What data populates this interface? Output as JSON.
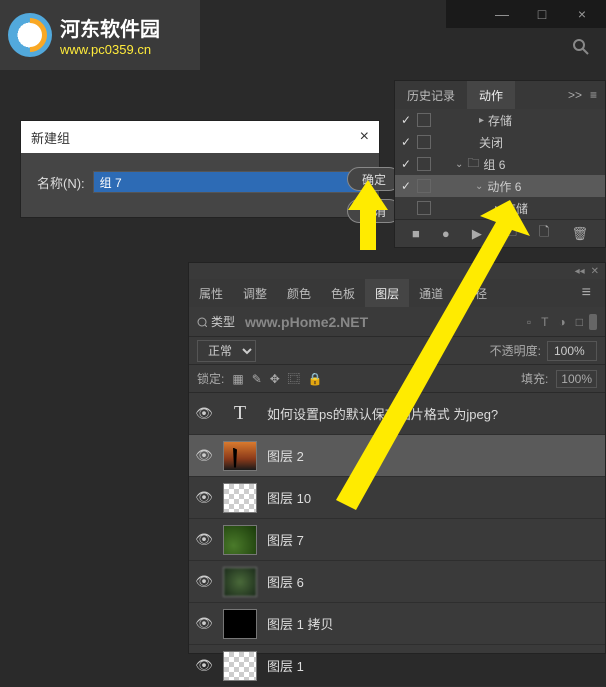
{
  "logo": {
    "title": "河东软件园",
    "subtitle": "www.pc0359.cn"
  },
  "titlebar": {
    "minimize": "—",
    "maximize": "□",
    "close": "×"
  },
  "dialog": {
    "title": "新建组",
    "close": "×",
    "name_label": "名称(N):",
    "name_value": "组 7",
    "ok": "确定",
    "cancel": "取消"
  },
  "actions_panel": {
    "tabs": {
      "history": "历史记录",
      "actions": "动作"
    },
    "menu": ">>",
    "burger": "≡",
    "items": [
      {
        "check": "✓",
        "arrow": "▸",
        "label": "存储",
        "indent": 40
      },
      {
        "check": "✓",
        "arrow": "",
        "label": "关闭",
        "indent": 40
      },
      {
        "check": "✓",
        "arrow": "⌄",
        "folder": "🗀",
        "label": "组 6",
        "indent": 16,
        "open": true
      },
      {
        "check": "✓",
        "arrow": "⌄",
        "label": "动作 6",
        "indent": 36,
        "selected": true
      },
      {
        "check": "",
        "arrow": "▸",
        "label": "存储",
        "indent": 56
      }
    ],
    "footer_icons": [
      "■",
      "●",
      "▶",
      "🗀",
      "🗋",
      "🗑"
    ]
  },
  "layers_panel": {
    "topbar": [
      "◂◂",
      "✕"
    ],
    "tabs": [
      "属性",
      "调整",
      "颜色",
      "色板",
      "图层",
      "通道",
      "路径"
    ],
    "active_tab": 4,
    "menu": "≡",
    "filter": {
      "kind_label": "类型",
      "watermark": "www.pHome2.NET",
      "icons": [
        "▫",
        "T",
        "◑",
        "□"
      ]
    },
    "blend": {
      "mode": "正常",
      "opacity_label": "不透明度:",
      "opacity_value": "100%"
    },
    "lock": {
      "label": "锁定:",
      "fill_label": "填充:",
      "fill_value": "100%"
    },
    "layers": [
      {
        "type": "text",
        "name": "如何设置ps的默认保存图片格式 为jpeg?"
      },
      {
        "type": "sunset",
        "name": "图层 2",
        "selected": true
      },
      {
        "type": "checker",
        "name": "图层 10"
      },
      {
        "type": "green",
        "name": "图层 7"
      },
      {
        "type": "blur",
        "name": "图层 6"
      },
      {
        "type": "black",
        "name": "图层 1 拷贝"
      },
      {
        "type": "checker",
        "name": "图层 1"
      }
    ]
  }
}
